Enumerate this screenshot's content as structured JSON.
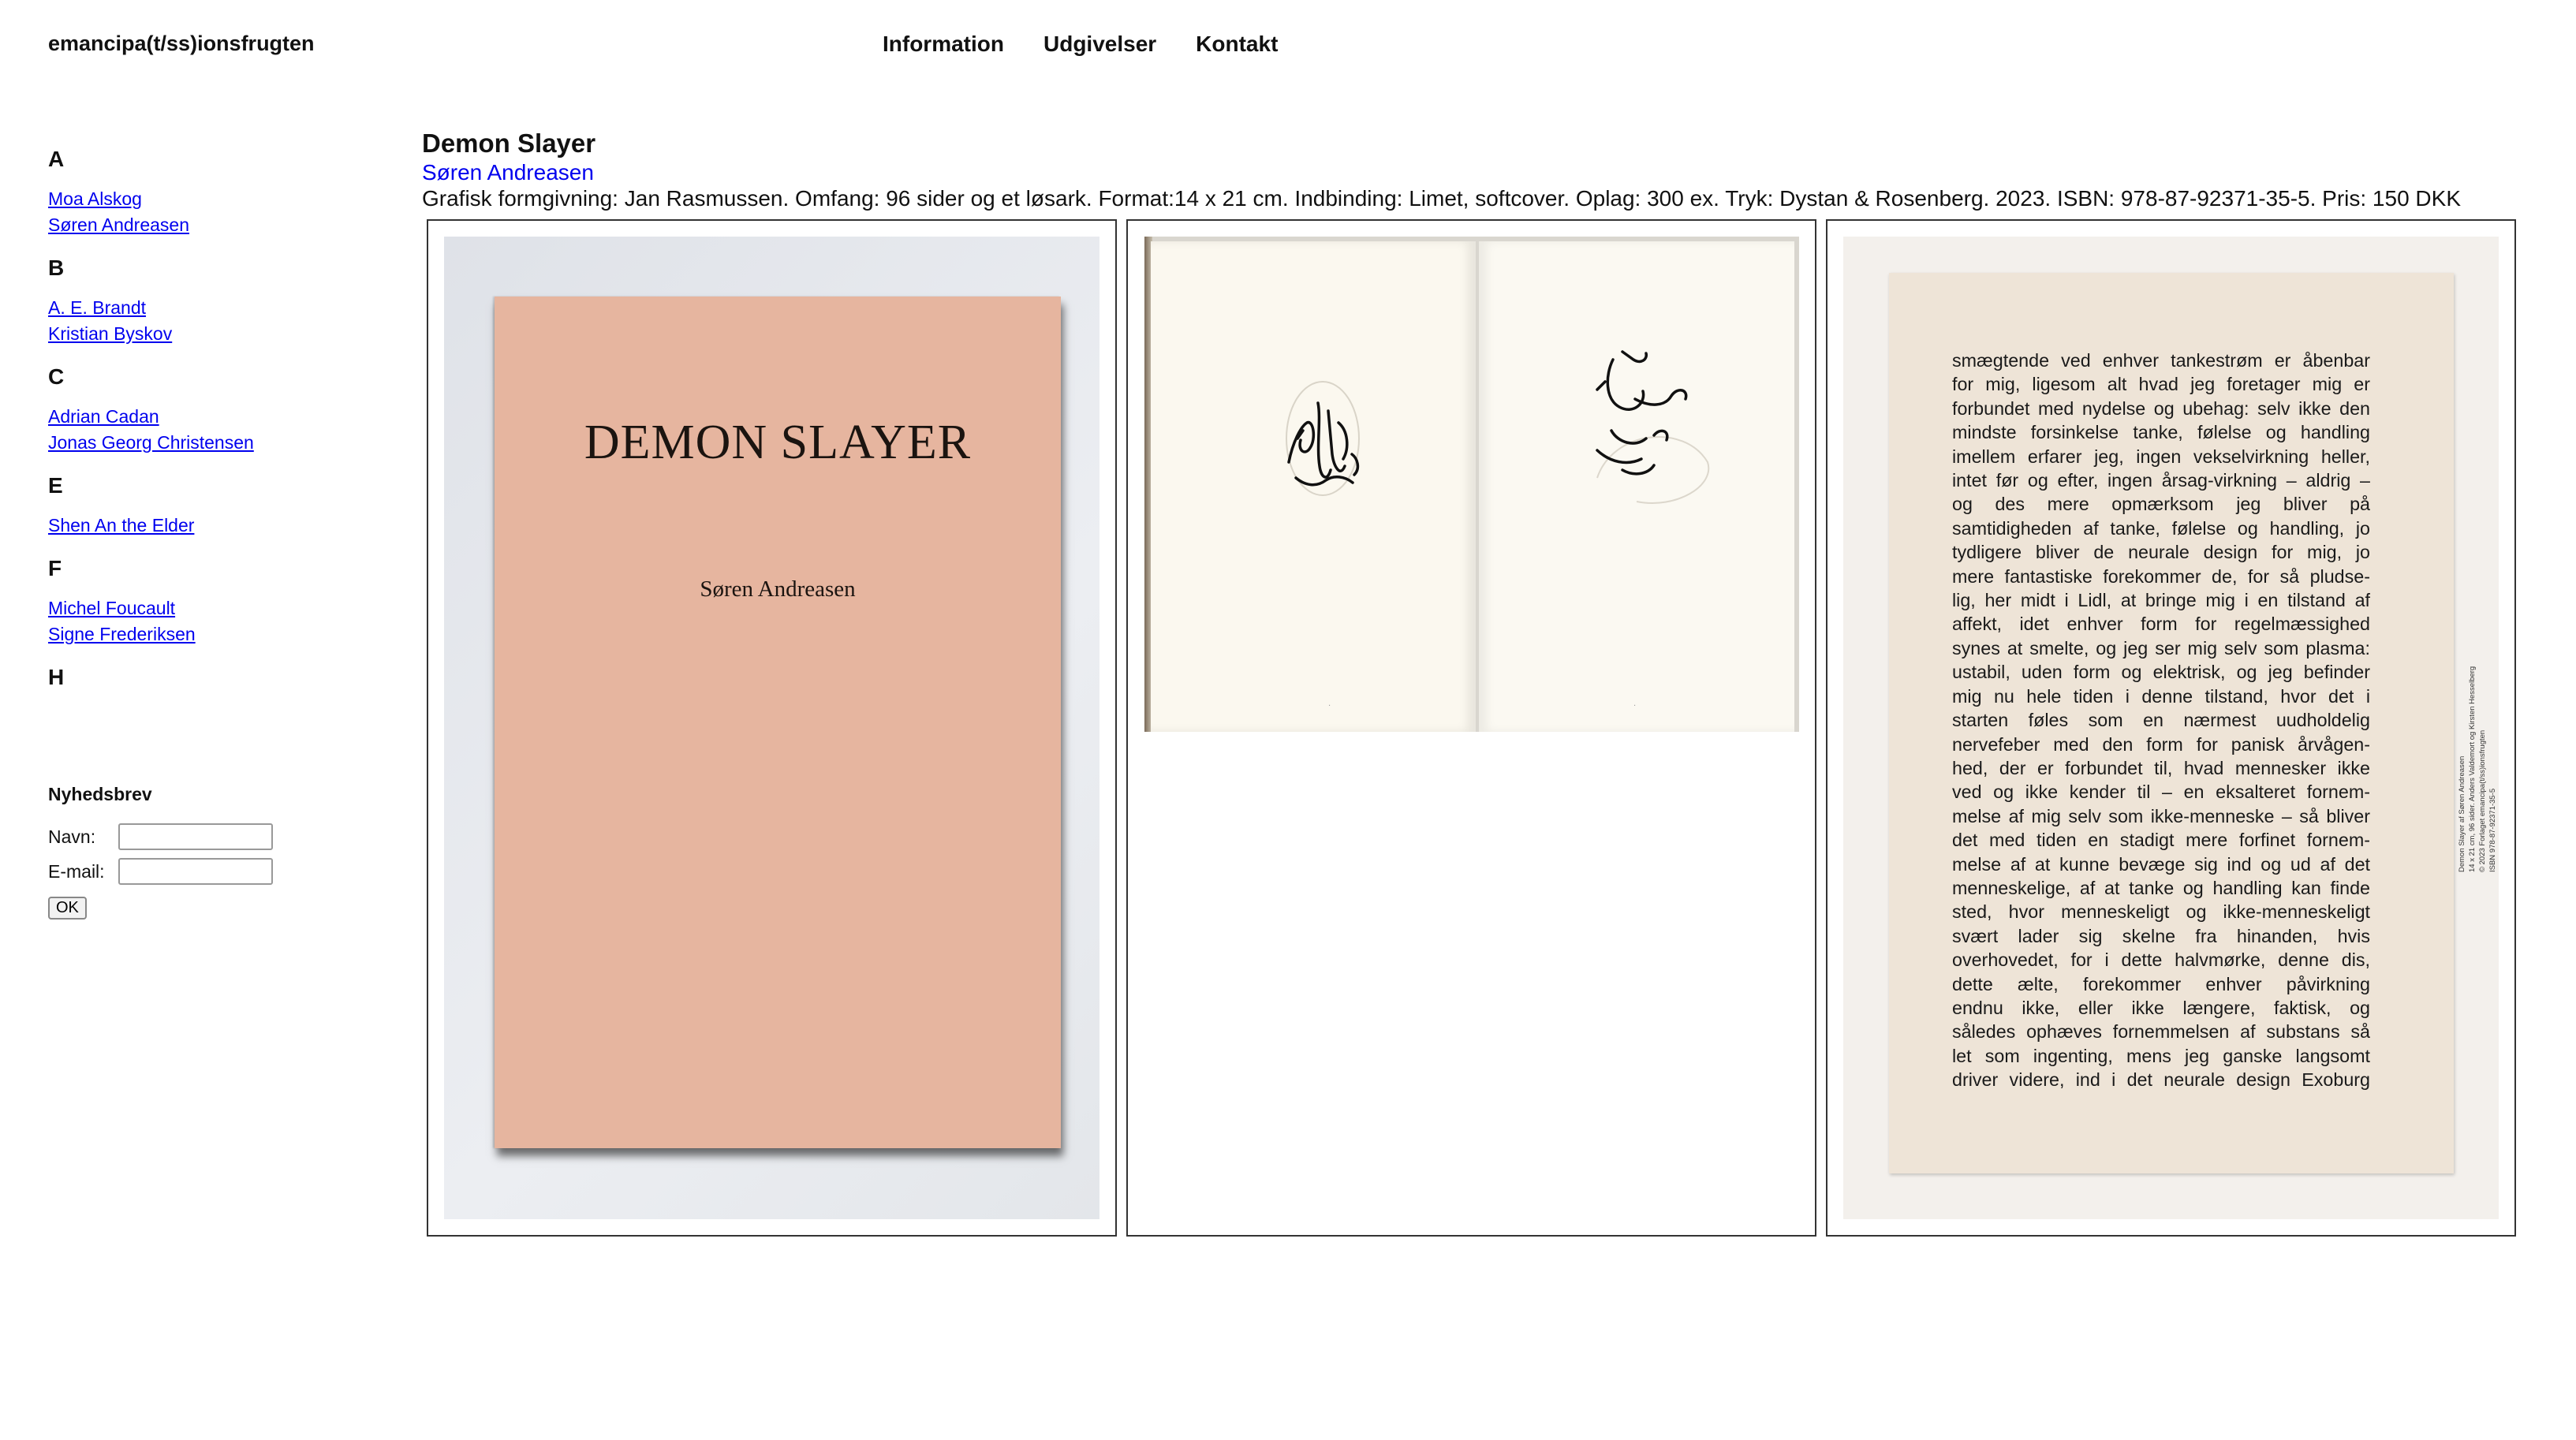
{
  "site": {
    "title": "emancipa(t/ss)ionsfrugten"
  },
  "nav": [
    "Information",
    "Udgivelser",
    "Kontakt"
  ],
  "sidebar": {
    "groups": [
      {
        "letter": "A",
        "authors": [
          "Moa Alskog",
          "Søren Andreasen"
        ]
      },
      {
        "letter": "B",
        "authors": [
          "A. E. Brandt",
          "Kristian Byskov"
        ]
      },
      {
        "letter": "C",
        "authors": [
          "Adrian Cadan",
          "Jonas Georg Christensen"
        ]
      },
      {
        "letter": "E",
        "authors": [
          "Shen An the Elder"
        ]
      },
      {
        "letter": "F",
        "authors": [
          "Michel Foucault",
          "Signe Frederiksen"
        ]
      },
      {
        "letter": "H",
        "authors": []
      }
    ]
  },
  "newsletter": {
    "heading": "Nyhedsbrev",
    "name_label": "Navn:",
    "email_label": "E-mail:",
    "submit_label": "OK"
  },
  "book": {
    "title": "Demon Slayer",
    "author": "Søren Andreasen",
    "meta": "Grafisk formgivning: Jan Rasmussen. Omfang: 96 sider og et løsark. Format:14 x 21 cm. Indbinding: Limet, softcover. Oplag: 300 ex. Tryk: Dystan & Rosenberg. 2023. ISBN: 978-87-92371-35-5. Pris: 150 DKK",
    "cover": {
      "title": "DEMON SLAYER",
      "author": "Søren Andreasen",
      "color": "#e6b59f"
    },
    "back_lines": [
      "smægtende ved enhver tankestrøm er åbenbar",
      "for mig, ligesom alt hvad jeg foretager mig er",
      "forbundet med nydelse og ubehag: selv ikke den",
      "mindste forsinkelse tanke, følelse og handling",
      "imellem erfarer jeg, ingen vekselvirkning heller,",
      "intet før og efter, ingen årsag-virkning – aldrig –",
      "og des mere opmærksom jeg bliver på",
      "samtidigheden af tanke, følelse og handling, jo",
      "tydligere bliver de neurale design for mig, jo",
      "mere fantastiske forekommer de, for så pludse-",
      "lig, her midt i Lidl, at bringe mig i en tilstand af",
      "affekt, idet enhver form for regelmæssighed",
      "synes at smelte, og jeg ser mig selv som plasma:",
      "ustabil, uden form og elektrisk, og jeg befinder",
      "mig nu hele tiden i denne tilstand, hvor det i",
      "starten føles som en nærmest uudholdelig",
      "nervefeber med den form for panisk årvågen-",
      "hed, der er forbundet til, hvad mennesker ikke",
      "ved og ikke kender til – en eksalteret fornem-",
      "melse af mig selv som ikke-menneske – så bliver",
      "det med tiden en stadigt mere forfinet fornem-",
      "melse af at kunne bevæge sig ind og ud af det",
      "menneskelige, af at tanke og handling kan finde",
      "sted, hvor menneskeligt og ikke-menneskeligt",
      "svært lader sig skelne fra hinanden, hvis",
      "overhovedet, for i dette halvmørke, denne dis,",
      "dette ælte, forekommer enhver påvirkning",
      "endnu ikke, eller ikke længere, faktisk, og",
      "således ophæves fornemmelsen af substans så",
      "let som ingenting, mens jeg ganske langsomt",
      "driver videre, ind i det neurale design Exoburg"
    ],
    "colophon": [
      "Demon Slayer af Søren Andreasen",
      "14 x 21 cm, 96 sider. Anders Valdemort og Kirsten Hesselberg",
      "© 2023 Forlaget emancipa(t/ss)ionsfrugten",
      "ISBN 978-87-92371-35-5"
    ]
  }
}
